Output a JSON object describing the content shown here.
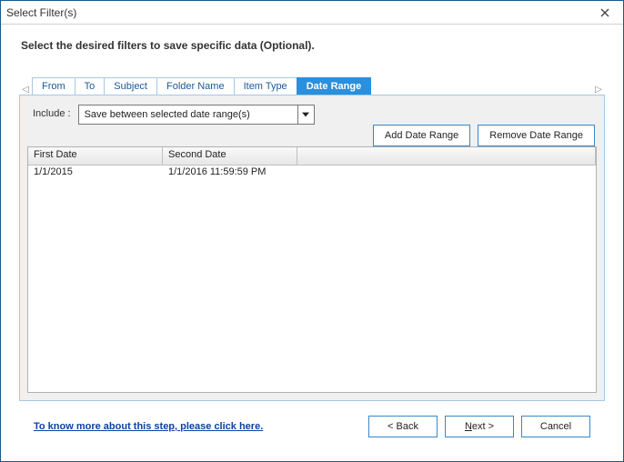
{
  "window": {
    "title": "Select Filter(s)"
  },
  "instruction": "Select the desired filters to save specific data (Optional).",
  "tabs": {
    "items": [
      "From",
      "To",
      "Subject",
      "Folder Name",
      "Item Type",
      "Date Range"
    ],
    "active_index": 5
  },
  "include": {
    "label": "Include :",
    "selected": "Save between selected date range(s)"
  },
  "actions": {
    "add": "Add Date Range",
    "remove": "Remove Date Range"
  },
  "grid": {
    "headers": {
      "first": "First Date",
      "second": "Second Date"
    },
    "rows": [
      {
        "first": "1/1/2015",
        "second": "1/1/2016 11:59:59 PM"
      }
    ]
  },
  "help_link": "To know more about this step, please click here.",
  "footer": {
    "back": "< Back",
    "next_prefix": "",
    "next_accel": "N",
    "next_suffix": "ext >",
    "cancel": "Cancel"
  }
}
